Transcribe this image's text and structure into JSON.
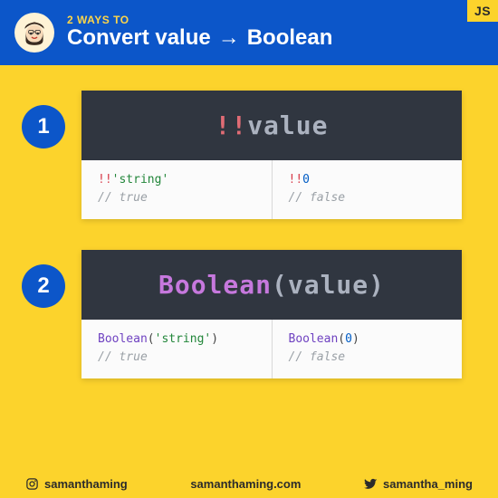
{
  "header": {
    "subtitle": "2 WAYS TO",
    "title_a": "Convert value",
    "title_arrow": "→",
    "title_b": "Boolean",
    "badge": "JS"
  },
  "blocks": [
    {
      "num": "1",
      "code": {
        "op": "!!",
        "var": "value"
      },
      "examples": [
        {
          "op": "!!",
          "str": "'string'",
          "comment": "// true"
        },
        {
          "op": "!!",
          "num": "0",
          "comment": "// false"
        }
      ]
    },
    {
      "num": "2",
      "code": {
        "fn": "Boolean",
        "lp": "(",
        "var": "value",
        "rp": ")"
      },
      "examples": [
        {
          "fn": "Boolean",
          "lp": "(",
          "str": "'string'",
          "rp": ")",
          "comment": "// true"
        },
        {
          "fn": "Boolean",
          "lp": "(",
          "num": "0",
          "rp": ")",
          "comment": "// false"
        }
      ]
    }
  ],
  "footer": {
    "instagram": "samanthaming",
    "site": "samanthaming.com",
    "twitter": "samantha_ming"
  }
}
